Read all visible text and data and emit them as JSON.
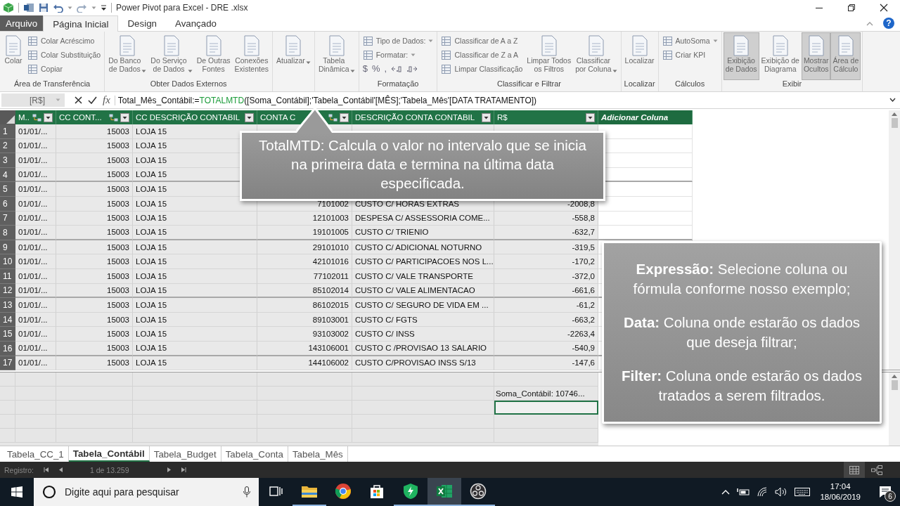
{
  "window": {
    "title": "Power Pivot para Excel - DRE .xlsx",
    "help": "?"
  },
  "ribbon_tabs": [
    {
      "label": "Arquivo",
      "kind": "file",
      "selected": false
    },
    {
      "label": "Página Inicial",
      "kind": "tab",
      "selected": true
    },
    {
      "label": "Design",
      "kind": "tab",
      "selected": false
    },
    {
      "label": "Avançado",
      "kind": "tab",
      "selected": false
    }
  ],
  "ribbon_groups": [
    {
      "label": "Área de Transferência",
      "items": [
        {
          "kind": "large",
          "lines": [
            "Colar"
          ]
        },
        {
          "kind": "stack",
          "items": [
            {
              "label": "Colar Acréscimo"
            },
            {
              "label": "Colar Substituição"
            },
            {
              "label": "Copiar"
            }
          ]
        }
      ]
    },
    {
      "label": "Obter Dados Externos",
      "items": [
        {
          "kind": "large",
          "lines": [
            "Do Banco",
            "de Dados"
          ],
          "dropdown": true
        },
        {
          "kind": "large",
          "lines": [
            "Do Serviço",
            "de Dados"
          ],
          "dropdown": true
        },
        {
          "kind": "large",
          "lines": [
            "De Outras",
            "Fontes"
          ]
        },
        {
          "kind": "large",
          "lines": [
            "Conexões",
            "Existentes"
          ]
        }
      ]
    },
    {
      "items": [
        {
          "kind": "large",
          "lines": [
            "Atualizar"
          ],
          "dropdown": true
        }
      ]
    },
    {
      "items": [
        {
          "kind": "large",
          "lines": [
            "Tabela",
            "Dinâmica"
          ],
          "dropdown": true
        }
      ]
    },
    {
      "label": "Formatação",
      "items": [
        {
          "kind": "stack",
          "items": [
            {
              "label": "Tipo de Dados:",
              "dropdown": true
            },
            {
              "label": "Formatar:",
              "dropdown": true
            },
            {
              "kind": "symbols",
              "symbols": [
                "$",
                "%",
                ","
              ]
            }
          ]
        }
      ]
    },
    {
      "label": "Classificar e Filtrar",
      "items": [
        {
          "kind": "stack",
          "items": [
            {
              "label": "Classificar de A a Z"
            },
            {
              "label": "Classificar de Z a A"
            },
            {
              "label": "Limpar Classificação"
            }
          ]
        },
        {
          "kind": "large",
          "lines": [
            "Limpar Todos",
            "os Filtros"
          ]
        },
        {
          "kind": "large",
          "lines": [
            "Classificar",
            "por Coluna"
          ],
          "dropdown": true
        }
      ]
    },
    {
      "label": "Localizar",
      "items": [
        {
          "kind": "large",
          "lines": [
            "Localizar"
          ]
        }
      ]
    },
    {
      "label": "Cálculos",
      "items": [
        {
          "kind": "stack",
          "items": [
            {
              "label": "AutoSoma",
              "dropdown": true
            },
            {
              "label": "Criar KPI"
            }
          ]
        }
      ]
    },
    {
      "label": "Exibir",
      "items": [
        {
          "kind": "large",
          "lines": [
            "Exibição",
            "de Dados"
          ],
          "selected": true
        },
        {
          "kind": "large",
          "lines": [
            "Exibição de",
            "Diagrama"
          ],
          "selected": false
        },
        {
          "kind": "large",
          "lines": [
            "Mostrar",
            "Ocultos"
          ],
          "selected": true
        },
        {
          "kind": "large",
          "lines": [
            "Área de",
            "Cálculo"
          ],
          "selected": true
        }
      ]
    }
  ],
  "formula_bar": {
    "name_box": "[R$]",
    "fx": "fx",
    "prefix": "Total_Mês_Contábil:=",
    "function": "TOTALMTD",
    "arguments": "([Soma_Contábil];'Tabela_Contábil'[MÊS];'Tabela_Mês'[DATA TRATAMENTO])"
  },
  "table": {
    "columns": [
      {
        "label": "M..",
        "kind": "data",
        "related": true
      },
      {
        "label": "CC CONT...",
        "kind": "data",
        "related": true
      },
      {
        "label": "CC DESCRIÇÃO CONTABIL",
        "kind": "data",
        "related": false
      },
      {
        "label": "CONTA C",
        "kind": "data",
        "related": true
      },
      {
        "label": "DESCRIÇÃO CONTA CONTABIL",
        "kind": "data",
        "related": false
      },
      {
        "label": "R$",
        "kind": "data",
        "related": false
      },
      {
        "label": "Adicionar Coluna",
        "kind": "add",
        "related": false
      }
    ],
    "rows": [
      {
        "number": "1",
        "cells": [
          "01/01/...",
          "15003",
          "LOJA 15"
        ]
      },
      {
        "number": "2",
        "cells": [
          "01/01/...",
          "15003",
          "LOJA 15"
        ]
      },
      {
        "number": "3",
        "cells": [
          "01/01/...",
          "15003",
          "LOJA 15"
        ]
      },
      {
        "number": "4",
        "cells": [
          "01/01/...",
          "15003",
          "LOJA 15"
        ]
      },
      {
        "number": "5",
        "cells": [
          "01/01/...",
          "15003",
          "LOJA 15"
        ]
      },
      {
        "number": "6",
        "cells": [
          "01/01/...",
          "15003",
          "LOJA 15",
          "7101002",
          "CUSTO C/ HORAS EXTRAS",
          "-2008,8"
        ]
      },
      {
        "number": "7",
        "cells": [
          "01/01/...",
          "15003",
          "LOJA 15",
          "12101003",
          "DESPESA C/ ASSESSORIA COME...",
          "-558,8"
        ]
      },
      {
        "number": "8",
        "cells": [
          "01/01/...",
          "15003",
          "LOJA 15",
          "19101005",
          "CUSTO C/ TRIENIO",
          "-632,7"
        ]
      },
      {
        "number": "9",
        "cells": [
          "01/01/...",
          "15003",
          "LOJA 15",
          "29101010",
          "CUSTO C/ ADICIONAL NOTURNO",
          "-319,5"
        ]
      },
      {
        "number": "10",
        "cells": [
          "01/01/...",
          "15003",
          "LOJA 15",
          "42101016",
          "CUSTO C/ PARTICIPACOES NOS L...",
          "-170,2"
        ]
      },
      {
        "number": "11",
        "cells": [
          "01/01/...",
          "15003",
          "LOJA 15",
          "77102011",
          "CUSTO C/ VALE TRANSPORTE",
          "-372,0"
        ]
      },
      {
        "number": "12",
        "cells": [
          "01/01/...",
          "15003",
          "LOJA 15",
          "85102014",
          "CUSTO C/ VALE ALIMENTACAO",
          "-661,6"
        ]
      },
      {
        "number": "13",
        "cells": [
          "01/01/...",
          "15003",
          "LOJA 15",
          "86102015",
          "CUSTO C/ SEGURO DE VIDA EM ...",
          "-61,2"
        ]
      },
      {
        "number": "14",
        "cells": [
          "01/01/...",
          "15003",
          "LOJA 15",
          "89103001",
          "CUSTO C/ FGTS",
          "-663,2"
        ]
      },
      {
        "number": "15",
        "cells": [
          "01/01/...",
          "15003",
          "LOJA 15",
          "93103002",
          "CUSTO C/ INSS",
          "-2263,4"
        ]
      },
      {
        "number": "16",
        "cells": [
          "01/01/...",
          "15003",
          "LOJA 15",
          "143106001",
          "CUSTO C /PROVISAO 13 SALARIO",
          "-540,9"
        ]
      },
      {
        "number": "17",
        "cells": [
          "01/01/...",
          "15003",
          "LOJA 15",
          "144106002",
          "CUSTO C/PROVISAO INSS S/13",
          "-147,6"
        ]
      }
    ]
  },
  "calculation_area": {
    "measure": "Soma_Contábil: 10746..."
  },
  "callouts": [
    {
      "kind": "pointer",
      "text": "TotalMTD: Calcula o valor no intervalo que se inicia na primeira data e termina na última data especificada."
    },
    {
      "kind": "box",
      "paragraphs": [
        "**Expressão:** Selecione coluna ou fórmula conforme nosso exemplo;",
        "**Data:** Coluna onde estarão os dados que deseja filtrar;",
        "**Filter:** Coluna onde estarão os dados tratados a serem filtrados."
      ]
    }
  ],
  "sheet_tabs": [
    {
      "label": "Tabela_CC_1",
      "selected": false
    },
    {
      "label": "Tabela_Contábil",
      "selected": true
    },
    {
      "label": "Tabela_Budget",
      "selected": false
    },
    {
      "label": "Tabela_Conta",
      "selected": false
    },
    {
      "label": "Tabela_Mês",
      "selected": false
    }
  ],
  "status_bar": {
    "label": "Registro:",
    "position": "1 de 13.259",
    "views": [
      {
        "kind": "grid",
        "selected": true
      },
      {
        "kind": "diagram",
        "selected": false
      }
    ]
  },
  "taskbar": {
    "search_placeholder": "Digite aqui para pesquisar",
    "apps": [
      {
        "kind": "taskview",
        "running": false,
        "active": false
      },
      {
        "kind": "folder",
        "running": true,
        "active": false
      },
      {
        "kind": "browser",
        "running": false,
        "active": false
      },
      {
        "kind": "store",
        "running": false,
        "active": false
      },
      {
        "kind": "shield",
        "running": true,
        "active": false
      },
      {
        "kind": "spreadsheet",
        "running": true,
        "active": true
      },
      {
        "kind": "recorder",
        "running": true,
        "active": false
      }
    ],
    "time": "17:04",
    "date": "18/06/2019",
    "notifications": "6"
  }
}
